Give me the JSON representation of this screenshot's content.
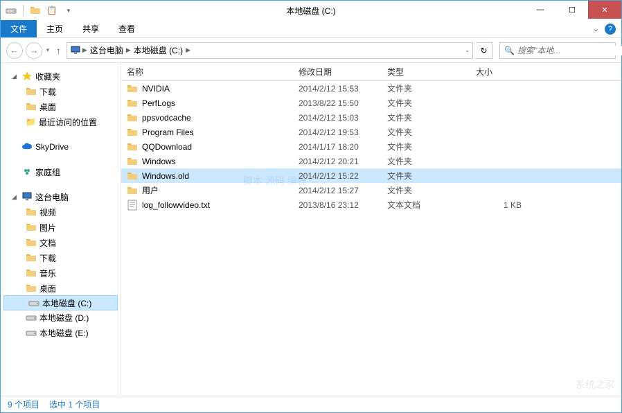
{
  "window": {
    "title": "本地磁盘 (C:)"
  },
  "ribbon": {
    "file": "文件",
    "tabs": [
      "主页",
      "共享",
      "查看"
    ]
  },
  "breadcrumb": {
    "parts": [
      "这台电脑",
      "本地磁盘 (C:)"
    ]
  },
  "search": {
    "placeholder": "搜索\"本地..."
  },
  "sidebar": {
    "favorites": {
      "label": "收藏夹",
      "items": [
        "下载",
        "桌面",
        "最近访问的位置"
      ]
    },
    "skydrive": "SkyDrive",
    "homegroup": "家庭组",
    "thispc": {
      "label": "这台电脑",
      "items": [
        "视频",
        "图片",
        "文档",
        "下载",
        "音乐",
        "桌面",
        "本地磁盘 (C:)",
        "本地磁盘 (D:)",
        "本地磁盘 (E:)"
      ]
    }
  },
  "columns": {
    "name": "名称",
    "date": "修改日期",
    "type": "类型",
    "size": "大小"
  },
  "files": [
    {
      "name": "NVIDIA",
      "date": "2014/2/12 15:53",
      "type": "文件夹",
      "size": "",
      "icon": "folder"
    },
    {
      "name": "PerfLogs",
      "date": "2013/8/22 15:50",
      "type": "文件夹",
      "size": "",
      "icon": "folder"
    },
    {
      "name": "ppsvodcache",
      "date": "2014/2/12 15:03",
      "type": "文件夹",
      "size": "",
      "icon": "folder"
    },
    {
      "name": "Program Files",
      "date": "2014/2/12 19:53",
      "type": "文件夹",
      "size": "",
      "icon": "folder"
    },
    {
      "name": "QQDownload",
      "date": "2014/1/17 18:20",
      "type": "文件夹",
      "size": "",
      "icon": "folder"
    },
    {
      "name": "Windows",
      "date": "2014/2/12 20:21",
      "type": "文件夹",
      "size": "",
      "icon": "folder"
    },
    {
      "name": "Windows.old",
      "date": "2014/2/12 15:22",
      "type": "文件夹",
      "size": "",
      "icon": "folder",
      "selected": true
    },
    {
      "name": "用户",
      "date": "2014/2/12 15:27",
      "type": "文件夹",
      "size": "",
      "icon": "folder"
    },
    {
      "name": "log_followvideo.txt",
      "date": "2013/8/16 23:12",
      "type": "文本文档",
      "size": "1 KB",
      "icon": "file"
    }
  ],
  "status": {
    "count": "9 个项目",
    "selected": "选中 1 个项目"
  },
  "watermark": {
    "main": "脚本 源码 编程",
    "corner": "系统之家"
  }
}
